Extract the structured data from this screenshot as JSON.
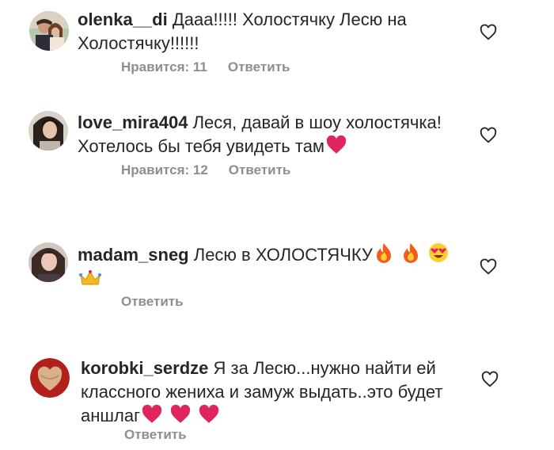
{
  "comments": [
    {
      "username": "olenka__di",
      "text": "Дааа!!!!! Холостячку Лесю на Холостячку!!!!!!",
      "likes": "Нравится: 11",
      "reply": "Ответить"
    },
    {
      "username": "love_mira404",
      "text": "Леся, давай в шоу холостячка! Хотелось бы тебя увидеть там",
      "likes": "Нравится: 12",
      "reply": "Ответить"
    },
    {
      "username": "madam_sneg",
      "text": "Лесю в ХОЛОСТЯЧКУ",
      "reply": "Ответить"
    },
    {
      "username": "korobki_serdze",
      "text": "Я за Лесю...нужно найти ей классного жениха и замуж выдать..это будет аншлаг",
      "reply": "Ответить"
    }
  ],
  "icons": {
    "like": "heart-outline-icon",
    "emoji_heart": "red-heart-emoji",
    "emoji_fire": "fire-emoji",
    "emoji_love_eyes": "heart-eyes-emoji",
    "emoji_crown": "crown-emoji"
  },
  "colors": {
    "text": "#262626",
    "secondary": "#8e8e8e",
    "heart": "#e0245e"
  }
}
